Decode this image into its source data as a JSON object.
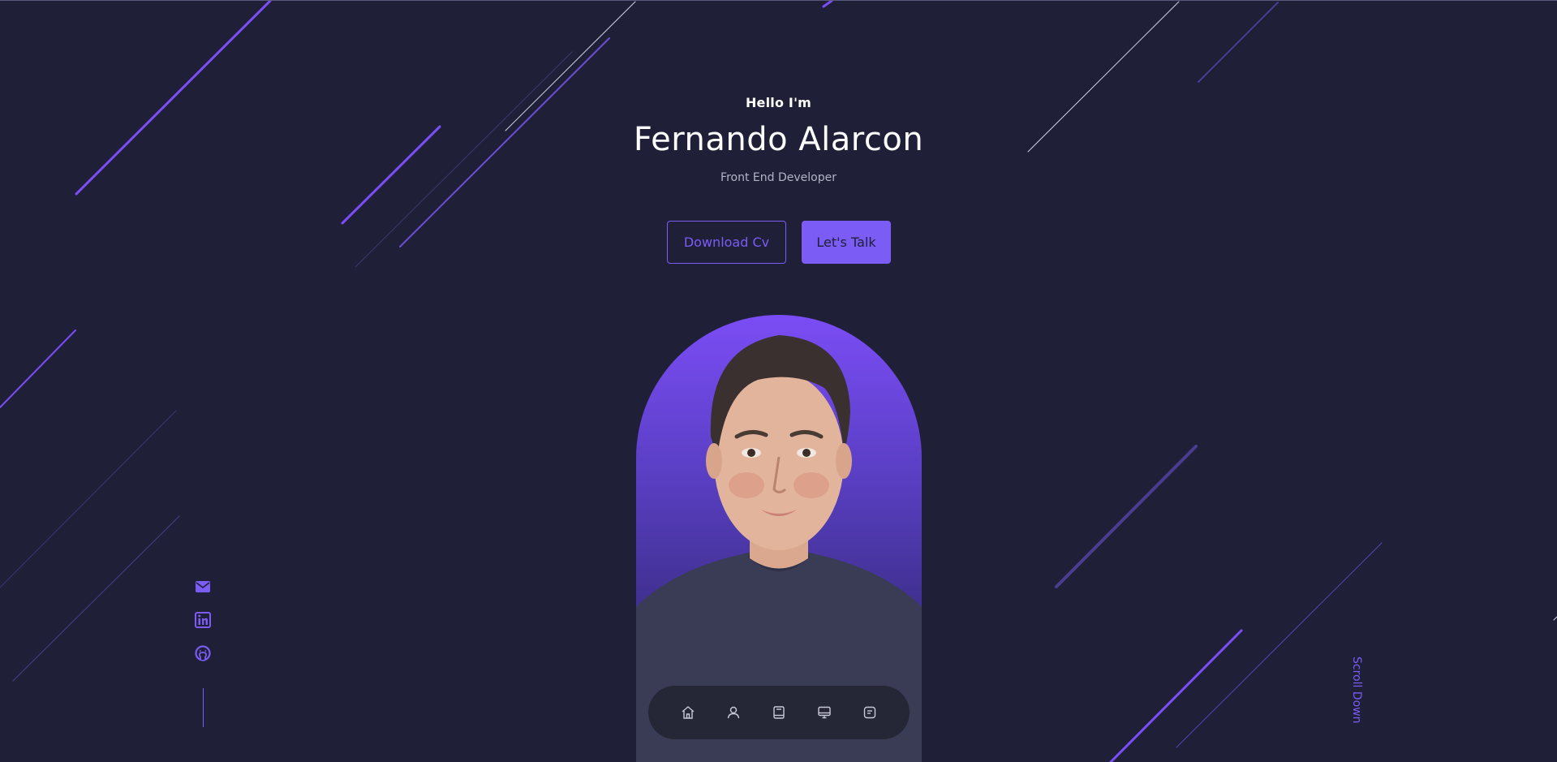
{
  "hero": {
    "greeting": "Hello I'm",
    "name": "Fernando Alarcon",
    "role": "Front End Developer"
  },
  "cta": {
    "download_label": "Download Cv",
    "talk_label": "Let's Talk"
  },
  "socials": [
    {
      "icon": "mail-icon"
    },
    {
      "icon": "linkedin-icon"
    },
    {
      "icon": "github-icon"
    }
  ],
  "scroll_label": "Scroll Down",
  "nav": [
    {
      "icon": "home-icon"
    },
    {
      "icon": "user-icon"
    },
    {
      "icon": "book-icon"
    },
    {
      "icon": "monitor-icon"
    },
    {
      "icon": "message-icon"
    }
  ],
  "colors": {
    "background": "#1f1f38",
    "accent": "#7b5cf5",
    "text": "#ffffff",
    "muted": "#b3b3c7"
  }
}
